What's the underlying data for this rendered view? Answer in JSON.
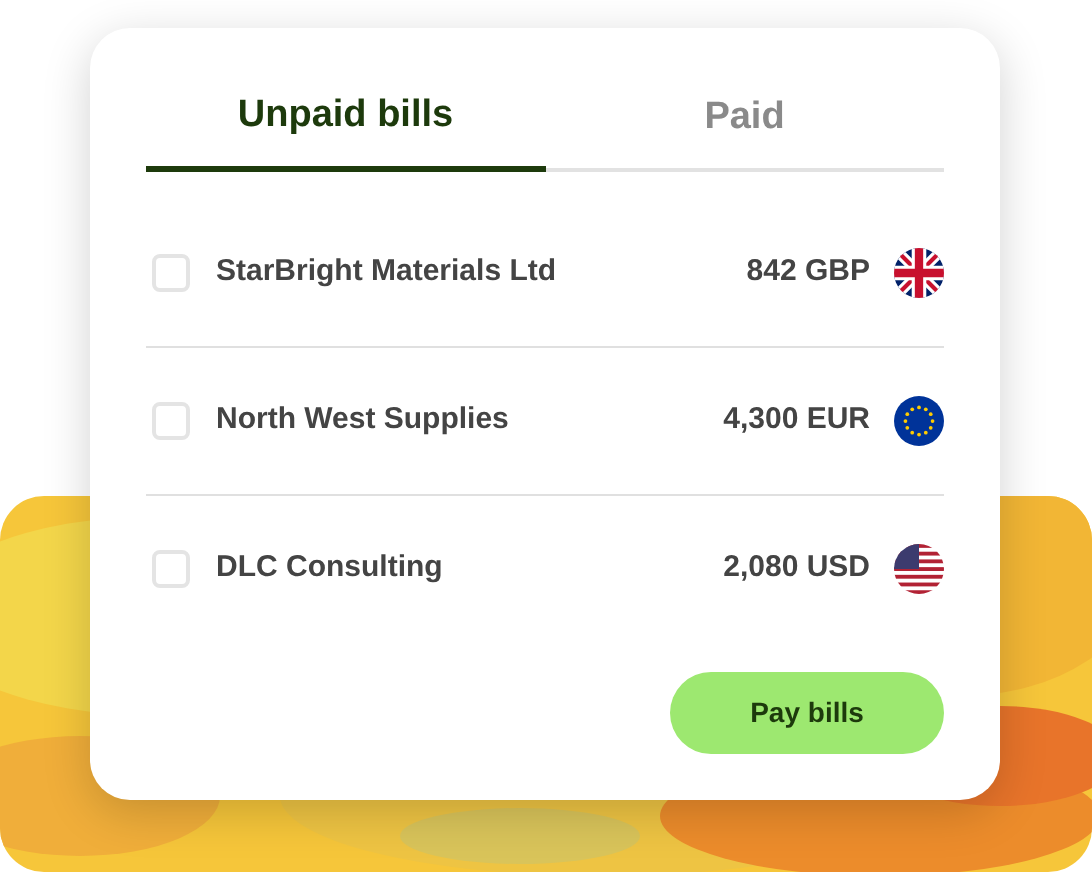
{
  "tabs": [
    {
      "label": "Unpaid bills",
      "selected": true
    },
    {
      "label": "Paid",
      "selected": false
    }
  ],
  "bills": [
    {
      "name": "StarBright Materials Ltd",
      "amount": "842 GBP",
      "checked": false,
      "kind": "uk"
    },
    {
      "name": "North West Supplies",
      "amount": "4,300 EUR",
      "checked": false,
      "kind": "eu"
    },
    {
      "name": "DLC Consulting",
      "amount": "2,080 USD",
      "checked": false,
      "kind": "us"
    }
  ],
  "pay_button": {
    "label": "Pay bills"
  }
}
